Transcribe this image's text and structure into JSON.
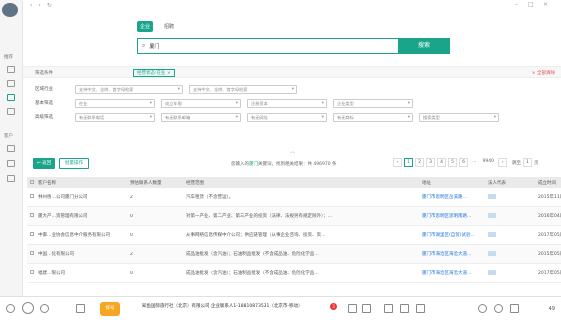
{
  "sidebar": {
    "items": [
      {
        "label": "推荐"
      },
      {
        "label": "客户"
      }
    ]
  },
  "tabs": [
    {
      "label": "企业"
    },
    {
      "label": "招聘"
    }
  ],
  "search": {
    "value": "厦门",
    "button": "搜索"
  },
  "filter": {
    "condition_label": "筛选条件",
    "chip": "经营状态:在业",
    "clear": "全部清除",
    "rows": [
      {
        "label": "区域行业",
        "selects": [
          "支持中文、全拼、首字母检索",
          "支持中文、全拼、首字母检索"
        ]
      },
      {
        "label": "基本筛选",
        "selects": [
          "在业",
          "成立年限",
          "注册资本",
          "企业类型"
        ]
      },
      {
        "label": "高级筛选",
        "selects": [
          "有无联系电话",
          "有无联系邮箱",
          "有无网址",
          "有无商标",
          "搜索类型"
        ]
      }
    ]
  },
  "toolbar": {
    "return": "返回",
    "batch": "批量操作",
    "hint_pre": "您输入的",
    "hint_kw": "厦门",
    "hint_post": "关键词，找到相关结果：共 496970 条",
    "pages": [
      "1",
      "2",
      "3",
      "4",
      "5",
      "6",
      "…",
      "9940"
    ],
    "jump_label": "跳至",
    "jump_value": "1",
    "jump_unit": "页"
  },
  "table": {
    "headers": [
      "客户名称",
      "预估联系人数量",
      "经营范围",
      "地址",
      "法人代表",
      "成立时间"
    ],
    "rows": [
      {
        "name": "林州梧…公司厦门分公司",
        "count": "2",
        "scope": "汽车租赁（不含营运）。",
        "addr": "厦门市思明区岳溪路…",
        "date": "2015年11月02日"
      },
      {
        "name": "厦大产…资管理有限公司",
        "count": "0",
        "scope": "对第一产业、第二产业、第三产业的投资（法律、法规另有规定除外）；…",
        "addr": "厦门市思明区思明南路…",
        "date": "2016年04月25日"
      },
      {
        "name": "中御…业协会信息中介服务有限公司",
        "count": "0",
        "scope": "从事网络信息传媒中介公司；供应链管理（从事企业咨询、投资、资…",
        "addr": "厦门市湖里区(自贸)试验…",
        "date": "2017年05月04日"
      },
      {
        "name": "中国…化有限公司",
        "count": "2",
        "scope": "成品油批发（含汽油）；石油制品批发（不含成品油、危险化学品…",
        "addr": "厦门市海沧区海沧大道…",
        "date": "2015年05月15日"
      },
      {
        "name": "福建…限公司",
        "count": "0",
        "scope": "成品油批发（含汽油）；石油制品批发（不含成品油、危险化学品…",
        "addr": "厦门市海沧区海沧大道…",
        "date": "2017年05月04日"
      }
    ]
  },
  "bottom": {
    "status": "拨号",
    "call_info": "知鱼国际旅行社（北京）有限公司 企业联系人1-18810873531（北京市-移动）",
    "badge": "3",
    "count": "49"
  }
}
